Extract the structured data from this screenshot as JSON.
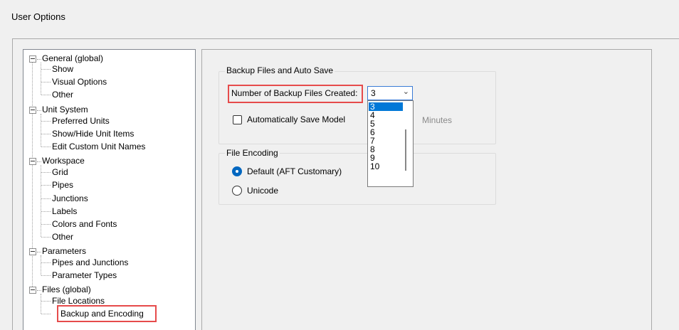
{
  "window": {
    "title": "User Options"
  },
  "tree": {
    "groups": [
      {
        "label": "General (global)",
        "children": [
          "Show",
          "Visual Options",
          "Other"
        ]
      },
      {
        "label": "Unit System",
        "children": [
          "Preferred Units",
          "Show/Hide Unit Items",
          "Edit Custom Unit Names"
        ]
      },
      {
        "label": "Workspace",
        "children": [
          "Grid",
          "Pipes",
          "Junctions",
          "Labels",
          "Colors and Fonts",
          "Other"
        ]
      },
      {
        "label": "Parameters",
        "children": [
          "Pipes and Junctions",
          "Parameter Types"
        ]
      },
      {
        "label": "Files (global)",
        "children": [
          "File Locations",
          "Backup and Encoding"
        ]
      }
    ],
    "selected": "Backup and Encoding"
  },
  "backup": {
    "group_title": "Backup Files and Auto Save",
    "count_label": "Number of Backup Files Created:",
    "count_value": "3",
    "dropdown_options": [
      "3",
      "4",
      "5",
      "6",
      "7",
      "8",
      "9",
      "10"
    ],
    "auto_save_label": "Automatically Save Model",
    "auto_save_checked": false,
    "minutes_label": "Minutes"
  },
  "encoding": {
    "group_title": "File Encoding",
    "options": [
      {
        "label": "Default (AFT Customary)",
        "checked": true
      },
      {
        "label": "Unicode",
        "checked": false
      }
    ]
  },
  "colors": {
    "highlight": "#e64b4b",
    "selection": "#0078d7",
    "radio_checked": "#0067c0"
  }
}
